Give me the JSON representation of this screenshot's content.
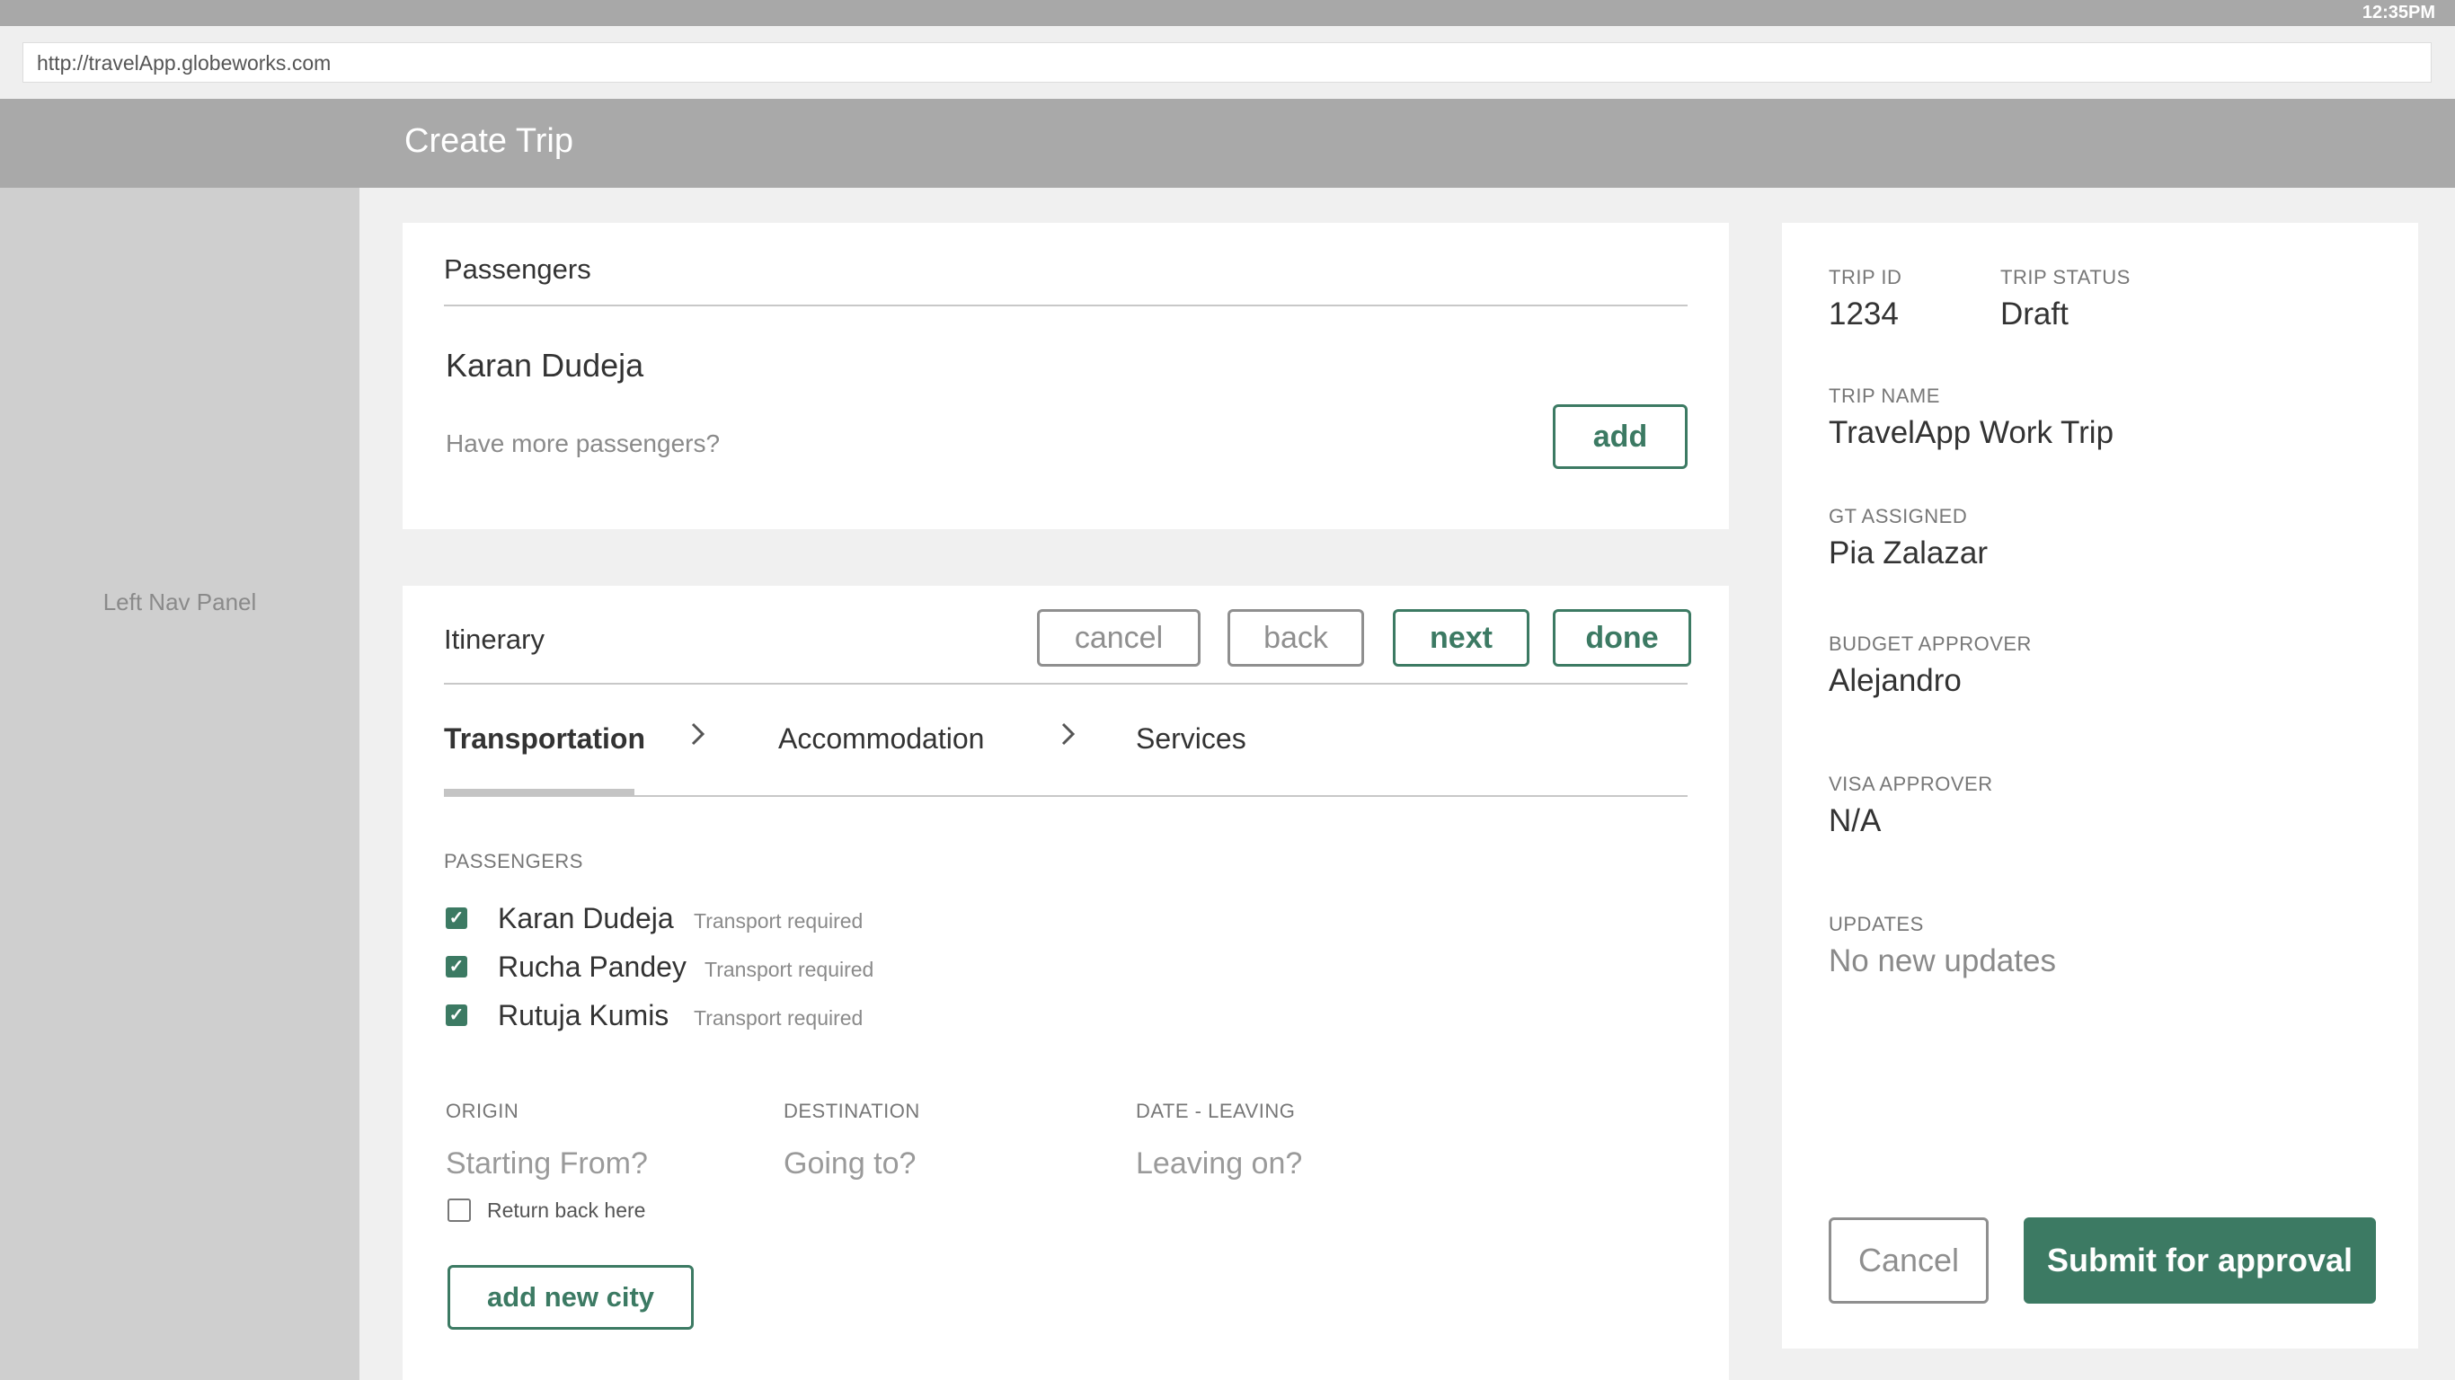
{
  "status_bar": {
    "time": "12:35PM"
  },
  "browser": {
    "url": "http://travelApp.globeworks.com"
  },
  "header": {
    "title": "Create Trip"
  },
  "left_nav": {
    "label": "Left Nav Panel"
  },
  "passengers_card": {
    "title": "Passengers",
    "passenger": "Karan Dudeja",
    "more_prompt": "Have more passengers?",
    "add_label": "add"
  },
  "itinerary": {
    "title": "Itinerary",
    "buttons": {
      "cancel": "cancel",
      "back": "back",
      "next": "next",
      "done": "done"
    },
    "steps": [
      "Transportation",
      "Accommodation",
      "Services"
    ],
    "active_step": "Transportation",
    "passengers_label": "PASSENGERS",
    "passengers": [
      {
        "name": "Karan Dudeja",
        "note": "Transport required",
        "checked": true
      },
      {
        "name": "Rucha Pandey",
        "note": "Transport required",
        "checked": true
      },
      {
        "name": "Rutuja Kumis",
        "note": "Transport required",
        "checked": true
      }
    ],
    "origin": {
      "label": "ORIGIN",
      "placeholder": "Starting From?"
    },
    "destination": {
      "label": "DESTINATION",
      "placeholder": "Going to?"
    },
    "date_leaving": {
      "label": "DATE - LEAVING",
      "placeholder": "Leaving on?"
    },
    "return_label": "Return back here",
    "return_checked": false,
    "add_city_label": "add new city"
  },
  "summary": {
    "trip_id_label": "TRIP ID",
    "trip_id": "1234",
    "trip_status_label": "TRIP STATUS",
    "trip_status": "Draft",
    "trip_name_label": "TRIP NAME",
    "trip_name": "TravelApp Work Trip",
    "gt_label": "GT ASSIGNED",
    "gt": "Pia Zalazar",
    "budget_label": "BUDGET APPROVER",
    "budget": "Alejandro",
    "visa_label": "VISA APPROVER",
    "visa": "N/A",
    "updates_label": "UPDATES",
    "updates": "No new updates",
    "cancel_label": "Cancel",
    "submit_label": "Submit for approval"
  },
  "colors": {
    "accent": "#3c7a63",
    "header": "#a9a9a9",
    "nav": "#cfcfcf"
  }
}
